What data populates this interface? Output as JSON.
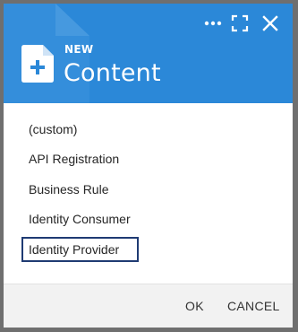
{
  "header": {
    "kicker": "NEW",
    "title": "Content",
    "icons": [
      "document-add-icon",
      "more-icon",
      "fullscreen-icon",
      "close-icon"
    ]
  },
  "content_types": [
    {
      "label": "(custom)"
    },
    {
      "label": "API Registration"
    },
    {
      "label": "Business Rule"
    },
    {
      "label": "Identity Consumer"
    },
    {
      "label": "Identity Provider",
      "focused": true
    }
  ],
  "footer": {
    "ok_label": "OK",
    "cancel_label": "CANCEL"
  },
  "colors": {
    "header_background": "#2b88d8",
    "focus_border": "#1f3b73",
    "footer_background": "#f2f2f2"
  }
}
